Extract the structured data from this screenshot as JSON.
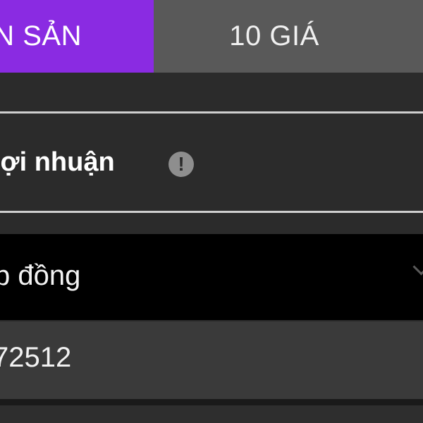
{
  "tabs": [
    {
      "label": "N SẢN",
      "active": true
    },
    {
      "label": "10 GIÁ",
      "active": false
    }
  ],
  "profit": {
    "label": "lợi nhuận",
    "info_icon": "info-icon"
  },
  "contract": {
    "label": "p đồng",
    "icon": "chevron-down-icon"
  },
  "value": {
    "text": "72512"
  },
  "colors": {
    "accent": "#8a2be2",
    "tab_inactive": "#595959",
    "background": "#2b2b2b",
    "select_background": "#000000"
  }
}
